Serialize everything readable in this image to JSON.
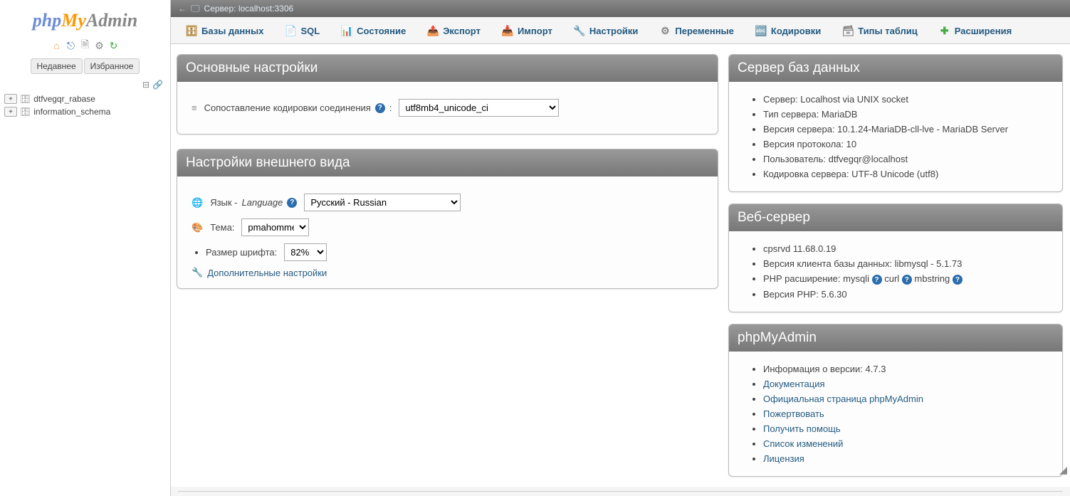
{
  "logo": {
    "p1": "php",
    "p2": "My",
    "p3": "Admin"
  },
  "sidebar": {
    "recent": "Недавнее",
    "favorite": "Избранное",
    "dbs": [
      "dtfvegqr_rabase",
      "information_schema"
    ]
  },
  "topstrip": {
    "server": "Сервер: localhost:3306"
  },
  "tabs": [
    {
      "icon": "ic-db",
      "glyph": "🗄",
      "label": "Базы данных"
    },
    {
      "icon": "ic-sql",
      "glyph": "📄",
      "label": "SQL"
    },
    {
      "icon": "ic-status",
      "glyph": "📊",
      "label": "Состояние"
    },
    {
      "icon": "ic-export",
      "glyph": "📤",
      "label": "Экспорт"
    },
    {
      "icon": "ic-import",
      "glyph": "📥",
      "label": "Импорт"
    },
    {
      "icon": "ic-settings",
      "glyph": "🔧",
      "label": "Настройки"
    },
    {
      "icon": "ic-vars",
      "glyph": "⚙",
      "label": "Переменные"
    },
    {
      "icon": "ic-charset",
      "glyph": "🔤",
      "label": "Кодировки"
    },
    {
      "icon": "ic-engines",
      "glyph": "🗃",
      "label": "Типы таблиц"
    },
    {
      "icon": "ic-plugins",
      "glyph": "✚",
      "label": "Расширения"
    }
  ],
  "general": {
    "title": "Основные настройки",
    "collation_label": "Сопоставление кодировки соединения",
    "collation_value": "utf8mb4_unicode_ci"
  },
  "appearance": {
    "title": "Настройки внешнего вида",
    "language_label": "Язык - ",
    "language_label2": "Language",
    "language_value": "Русский - Russian",
    "theme_label": "Тема:",
    "theme_value": "pmahomme",
    "font_label": "Размер шрифта:",
    "font_value": "82%",
    "more": "Дополнительные настройки"
  },
  "dbserver": {
    "title": "Сервер баз данных",
    "items": [
      "Сервер: Localhost via UNIX socket",
      "Тип сервера: MariaDB",
      "Версия сервера: 10.1.24-MariaDB-cll-lve - MariaDB Server",
      "Версия протокола: 10",
      "Пользователь: dtfvegqr@localhost",
      "Кодировка сервера: UTF-8 Unicode (utf8)"
    ]
  },
  "webserver": {
    "title": "Веб-сервер",
    "items": [
      "cpsrvd 11.68.0.19",
      "Версия клиента базы данных: libmysql - 5.1.73"
    ],
    "php_ext_prefix": "PHP расширение: ",
    "php_exts": [
      "mysqli",
      "curl",
      "mbstring"
    ],
    "php_version": "Версия PHP: 5.6.30"
  },
  "pma": {
    "title": "phpMyAdmin",
    "version": "Информация о версии: 4.7.3",
    "links": [
      "Документация",
      "Официальная страница phpMyAdmin",
      "Пожертвовать",
      "Получить помощь",
      "Список изменений",
      "Лицензия"
    ]
  }
}
